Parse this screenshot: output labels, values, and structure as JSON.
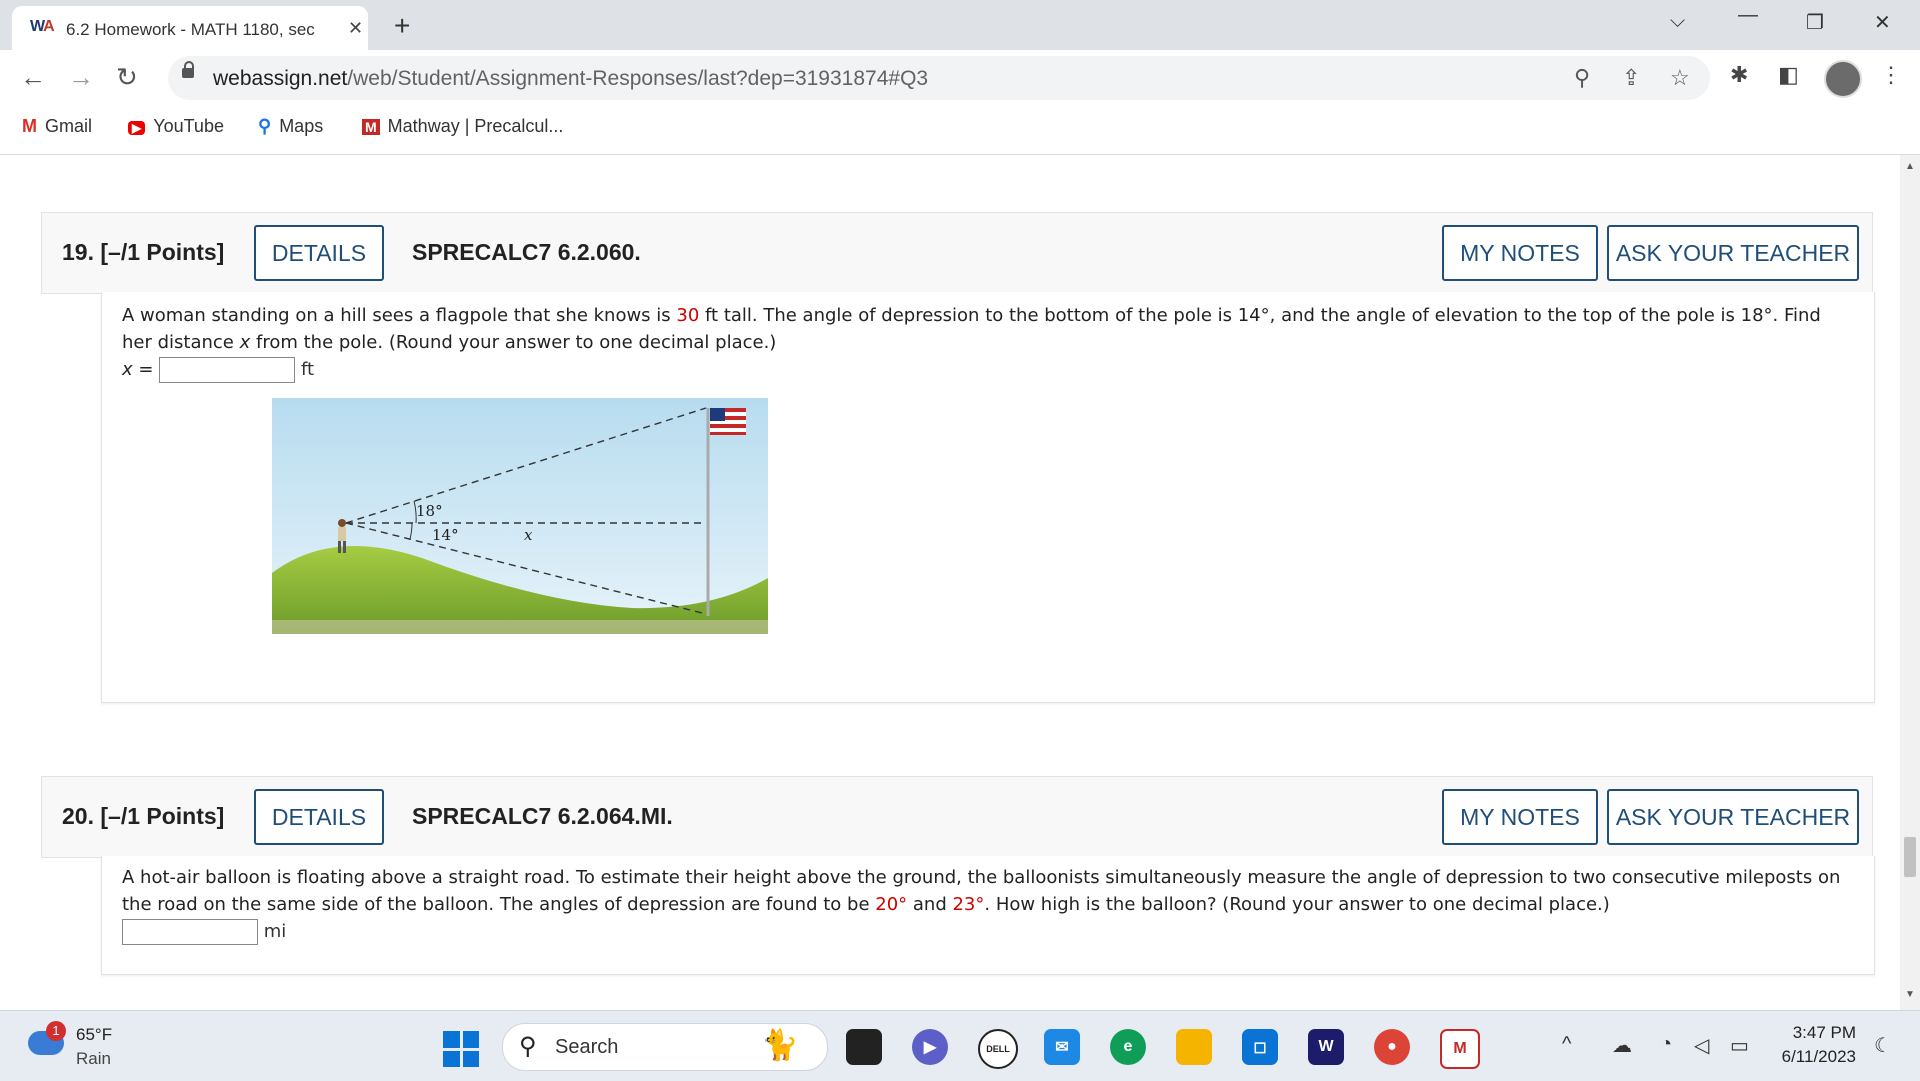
{
  "browser": {
    "tab_title": "6.2 Homework - MATH 1180, sec",
    "tab_favicon": "WA",
    "new_tab": "+",
    "tab_close": "✕",
    "url_host": "webassign.net",
    "url_path": "/web/Student/Assignment-Responses/last?dep=31931874#Q3",
    "bookmarks": [
      {
        "label": "Gmail",
        "icon": "gmail-icon"
      },
      {
        "label": "YouTube",
        "icon": "youtube-icon"
      },
      {
        "label": "Maps",
        "icon": "maps-icon"
      },
      {
        "label": "Mathway | Precalcul...",
        "icon": "mathway-icon"
      }
    ]
  },
  "questions": [
    {
      "number": "19.",
      "points": "[–/1 Points]",
      "details_label": "DETAILS",
      "code": "SPRECALC7 6.2.060.",
      "notes_label": "MY NOTES",
      "teacher_label": "ASK YOUR TEACHER",
      "text_a": "A woman standing on a hill sees a flagpole that she knows is ",
      "height_value": "30",
      "text_b": " ft tall. The angle of depression to the bottom of the pole is 14°, and the angle of elevation to the top of the pole is 18°. Find her distance ",
      "var_x": "x",
      "text_c": " from the pole. (Round your answer to one decimal place.)",
      "answer_prefix": "x =",
      "answer_unit": "ft",
      "figure": {
        "angle_top": "18°",
        "angle_bottom": "14°",
        "distance_label": "x"
      }
    },
    {
      "number": "20.",
      "points": "[–/1 Points]",
      "details_label": "DETAILS",
      "code": "SPRECALC7 6.2.064.MI.",
      "notes_label": "MY NOTES",
      "teacher_label": "ASK YOUR TEACHER",
      "text_a": "A hot-air balloon is floating above a straight road. To estimate their height above the ground, the balloonists simultaneously measure the angle of depression to two consecutive mileposts on the road on the same side of the balloon. The angles of depression are found to be ",
      "angle1": "20°",
      "text_b": " and ",
      "angle2": "23°",
      "text_c": ". How high is the balloon? (Round your answer to one decimal place.)",
      "answer_unit": "mi"
    }
  ],
  "taskbar": {
    "weather_badge": "1",
    "temperature": "65°F",
    "condition": "Rain",
    "search_label": "Search",
    "time": "3:47 PM",
    "date": "6/11/2023"
  },
  "colors": {
    "accent_blue": "#1f4e79",
    "red_value": "#d00000"
  }
}
